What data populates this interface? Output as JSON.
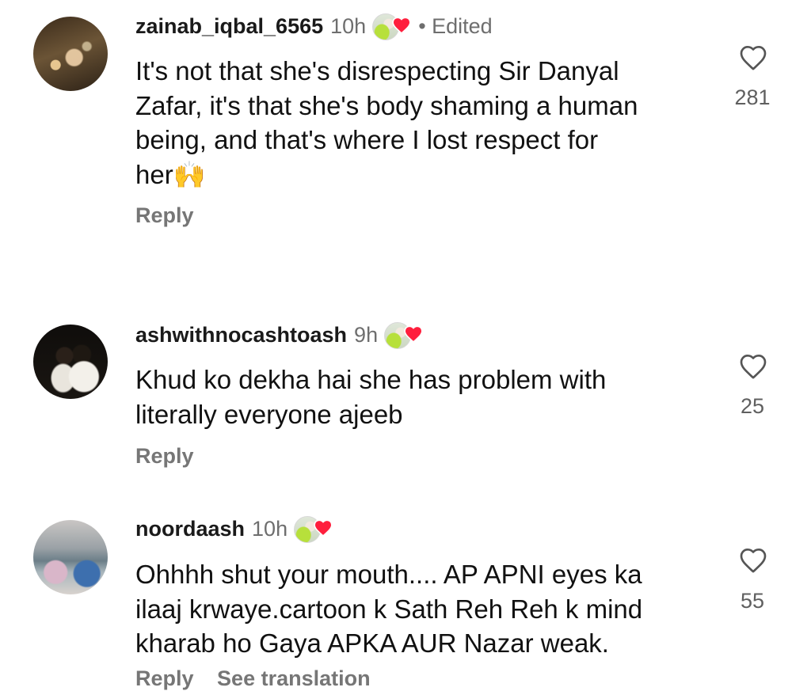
{
  "comments": [
    {
      "username": "zainab_iqbal_6565",
      "time": "10h",
      "edited": "• Edited",
      "text_lines": [
        "It's not that she's disrespecting Sir Danyal",
        "Zafar, it's that she's body shaming a human",
        "being, and that's where I lost respect for",
        "her🙌"
      ],
      "reply_label": "Reply",
      "like_count": "281",
      "like_icon": "heart-outline-icon",
      "liked_by_icon": "liked-by-creator-heart-icon"
    },
    {
      "username": "ashwithnocashtoash",
      "time": "9h",
      "text_lines": [
        "Khud ko dekha hai she has problem with",
        "literally everyone ajeeb"
      ],
      "reply_label": "Reply",
      "like_count": "25",
      "like_icon": "heart-outline-icon",
      "liked_by_icon": "liked-by-creator-heart-icon"
    },
    {
      "username": "noordaash",
      "time": "10h",
      "text_lines": [
        "Ohhhh shut your mouth.... AP APNI eyes ka",
        "ilaaj krwaye.cartoon k Sath Reh Reh k mind",
        "kharab ho Gaya APKA AUR Nazar weak."
      ],
      "reply_label": "Reply",
      "partial_action": "See translation",
      "like_count": "55",
      "like_icon": "heart-outline-icon",
      "liked_by_icon": "liked-by-creator-heart-icon"
    }
  ],
  "colors": {
    "text": "#111111",
    "secondary": "#6e6e6e",
    "heart_red": "#ff1f3d"
  }
}
